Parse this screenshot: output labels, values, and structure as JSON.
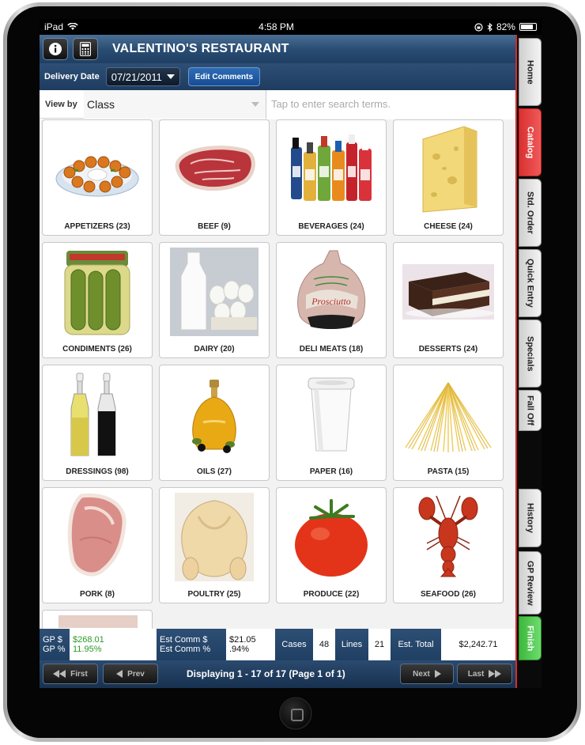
{
  "status_bar": {
    "device": "iPad",
    "time": "4:58 PM",
    "battery": "82%",
    "battery_level": 0.82
  },
  "header": {
    "title": "VALENTINO'S RESTAURANT",
    "info_icon": "info-icon",
    "calculator_icon": "calculator-icon"
  },
  "delivery": {
    "label": "Delivery Date",
    "date": "07/21/2011",
    "edit_comments": "Edit Comments"
  },
  "filter": {
    "view_by_label": "View by",
    "view_by_value": "Class",
    "search_placeholder": "Tap to enter search terms."
  },
  "categories": [
    {
      "label": "APPETIZERS (23)",
      "icon": "appetizer-platter-icon"
    },
    {
      "label": "BEEF (9)",
      "icon": "steak-icon"
    },
    {
      "label": "BEVERAGES (24)",
      "icon": "bottles-icon"
    },
    {
      "label": "CHEESE (24)",
      "icon": "cheese-wedge-icon"
    },
    {
      "label": "CONDIMENTS (26)",
      "icon": "pickle-jar-icon"
    },
    {
      "label": "DAIRY (20)",
      "icon": "milk-eggs-icon"
    },
    {
      "label": "DELI MEATS (18)",
      "icon": "ham-icon"
    },
    {
      "label": "DESSERTS (24)",
      "icon": "cake-icon"
    },
    {
      "label": "DRESSINGS (98)",
      "icon": "cruet-bottles-icon"
    },
    {
      "label": "OILS (27)",
      "icon": "oil-bottle-icon"
    },
    {
      "label": "PAPER (16)",
      "icon": "paper-cup-icon"
    },
    {
      "label": "PASTA (15)",
      "icon": "spaghetti-icon"
    },
    {
      "label": "PORK (8)",
      "icon": "pork-chop-icon"
    },
    {
      "label": "POULTRY (25)",
      "icon": "chicken-icon"
    },
    {
      "label": "PRODUCE (22)",
      "icon": "tomato-icon"
    },
    {
      "label": "SEAFOOD (26)",
      "icon": "lobster-icon"
    },
    {
      "label": "",
      "icon": "partial-tile-icon"
    }
  ],
  "summary": {
    "gp_dollar_label": "GP $",
    "gp_dollar_value": "$268.01",
    "gp_pct_label": "GP %",
    "gp_pct_value": "11.95%",
    "est_comm_dollar_label": "Est Comm $",
    "est_comm_dollar_value": "$21.05",
    "est_comm_pct_label": "Est Comm %",
    "est_comm_pct_value": ".94%",
    "cases_label": "Cases",
    "cases_value": "48",
    "lines_label": "Lines",
    "lines_value": "21",
    "est_total_label": "Est. Total",
    "est_total_value": "$2,242.71"
  },
  "pagination": {
    "first": "First",
    "prev": "Prev",
    "next": "Next",
    "last": "Last",
    "display": "Displaying 1 - 17 of 17 (Page 1 of 1)"
  },
  "side_tabs": [
    {
      "label": "Home"
    },
    {
      "label": "Catalog",
      "active": true
    },
    {
      "label": "Std. Order"
    },
    {
      "label": "Quick Entry"
    },
    {
      "label": "Specials"
    },
    {
      "label": "Fall Off"
    },
    {
      "label": "History"
    },
    {
      "label": "GP Review"
    },
    {
      "label": "Finish"
    }
  ],
  "colors": {
    "header_blue": "#2a4d73",
    "active_tab": "#d93030",
    "finish_tab": "#3cb83c",
    "gp_green": "#2a9a2a"
  }
}
